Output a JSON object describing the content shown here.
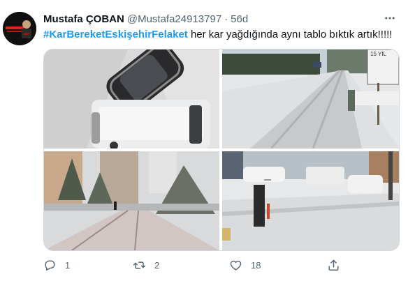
{
  "tweet": {
    "name": "Mustafa ÇOBAN",
    "handle": "@Mustafa24913797",
    "separator": "·",
    "time": "56d",
    "hashtag": "#KarBereketEskişehirFelaket",
    "text": " her kar yağdığında aynı tablo bıktık artık!!!!!"
  },
  "media": {
    "photos": [
      {
        "subject": "snow-covered cars crashed"
      },
      {
        "subject": "snowy city avenue"
      },
      {
        "subject": "snowy residential street"
      },
      {
        "subject": "snowy intersection with cars"
      }
    ],
    "sign_text": "15 YIL"
  },
  "actions": {
    "reply_count": "1",
    "retweet_count": "2",
    "like_count": "18"
  },
  "icons": [
    "more-icon",
    "reply-icon",
    "retweet-icon",
    "like-icon",
    "share-icon"
  ],
  "colors": {
    "hashtag": "#1d9bf0",
    "muted": "#536471",
    "border": "#cfd9de"
  }
}
